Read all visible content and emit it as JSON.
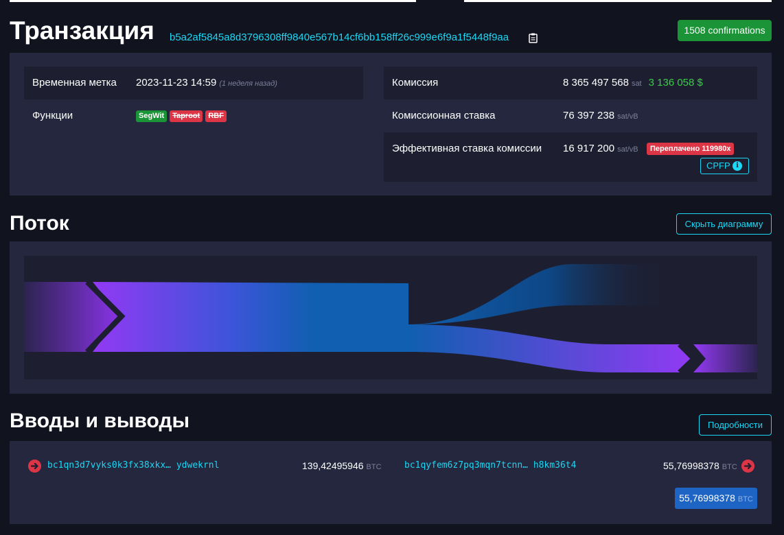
{
  "header": {
    "title": "Транзакция",
    "txid": "b5a2af5845a8d3796308ff9840e567b14cf6bb158ff26c999e6f9a1f5448f9aa",
    "confirmations": "1508 confirmations"
  },
  "details": {
    "timestamp": {
      "label": "Временная метка",
      "value": "2023-11-23 14:59",
      "relative": "(1 неделя назад)"
    },
    "features": {
      "label": "Функции",
      "tags": [
        "SegWit",
        "Taproot",
        "RBF"
      ]
    },
    "fee": {
      "label": "Комиссия",
      "value": "8 365 497 568",
      "unit": "sat",
      "usd": "3 136 058 $"
    },
    "fee_rate": {
      "label": "Комиссионная ставка",
      "value": "76 397 238",
      "unit": "sat/vB"
    },
    "effective_rate": {
      "label": "Эффективная ставка комиссии",
      "value": "16 917 200",
      "unit": "sat/vB",
      "overpaid": "Переплачено 119980x",
      "cpfp_label": "CPFP"
    }
  },
  "flow": {
    "title": "Поток",
    "hide_button": "Скрыть диаграмму"
  },
  "io": {
    "title": "Вводы и выводы",
    "details_button": "Подробности",
    "input": {
      "address": "bc1qn3d7vyks0k3fx38xkx… ydwekrnl",
      "amount": "139,42495946",
      "unit": "BTC"
    },
    "output": {
      "address": "bc1qyfem6z7pq3mqn7tcnn… h8km36t4",
      "amount": "55,76998378",
      "unit": "BTC"
    },
    "total": {
      "amount": "55,76998378",
      "unit": "BTC"
    }
  },
  "colors": {
    "accent": "#1bd8f4",
    "success": "#1a9436",
    "danger": "#dc3545",
    "flow_purple": "#9339f4",
    "flow_blue": "#105fb0"
  }
}
